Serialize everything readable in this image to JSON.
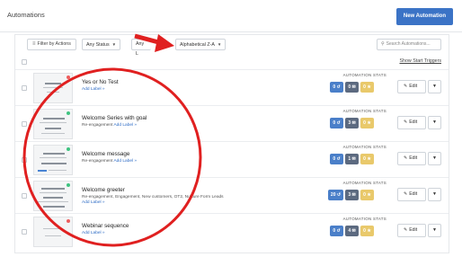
{
  "header": {
    "title": "Automations",
    "new_button": "New Automation"
  },
  "toolbar": {
    "filter_label": "Filter by Actions",
    "status_select": "Any Status",
    "list_select": "Any L",
    "sort_select": "Alphabetical Z-A",
    "search_placeholder": "Search Automations...",
    "show_triggers": "Show Start Triggers"
  },
  "stats_heading": "AUTOMATION STATS",
  "edit_label": "Edit",
  "rows": [
    {
      "name": "Yes or No Test",
      "category": "",
      "label": "Add Label »",
      "status": "inactive",
      "stat_active": "0",
      "stat_done": "0",
      "stat_goal": "0"
    },
    {
      "name": "Welcome Series with goal",
      "category": "Re-engagement",
      "label": "Add Label »",
      "status": "active",
      "stat_active": "0",
      "stat_done": "3",
      "stat_goal": "0"
    },
    {
      "name": "Welcome message",
      "category": "Re-engagement",
      "label": "Add Label »",
      "status": "active",
      "stat_active": "0",
      "stat_done": "1",
      "stat_goal": "0"
    },
    {
      "name": "Welcome greeter",
      "category": "Re-engagement, Engagement, New customers, OT2, Nurture Form Leads",
      "label": "Add Label »",
      "status": "active",
      "stat_active": "20",
      "stat_done": "3",
      "stat_goal": "0"
    },
    {
      "name": "Webinar sequence",
      "category": "",
      "label": "Add Label »",
      "status": "inactive",
      "stat_active": "0",
      "stat_done": "4",
      "stat_goal": "0"
    }
  ],
  "colors": {
    "accent": "#3b73c6",
    "annotation": "#e02020",
    "active_dot": "#3fc380",
    "inactive_dot": "#ee5d5d",
    "stat_blue": "#4a7fc9",
    "stat_gray": "#5c6a80",
    "stat_gold": "#e9c96b"
  }
}
